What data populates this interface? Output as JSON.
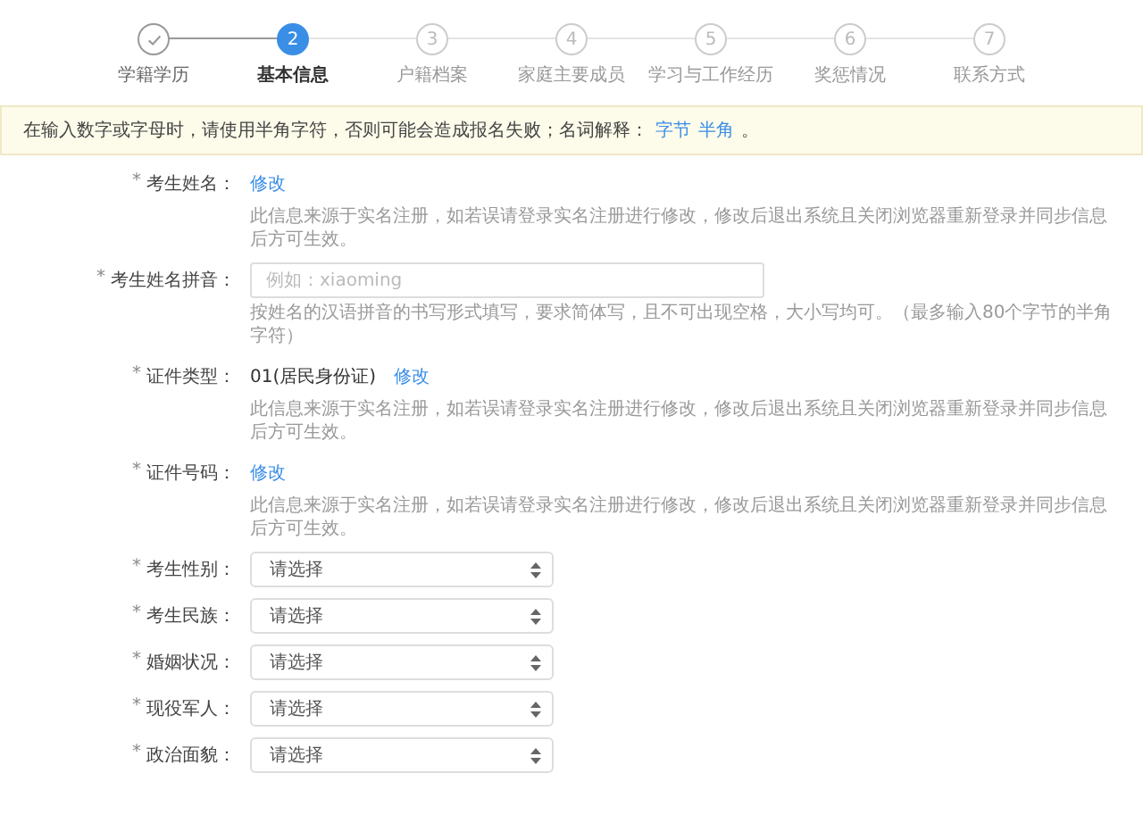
{
  "steps": [
    {
      "label": "学籍学历",
      "completed": true,
      "selected": false
    },
    {
      "number": "2",
      "label": "基本信息",
      "completed": false,
      "selected": true
    },
    {
      "number": "3",
      "label": "户籍档案",
      "completed": false,
      "selected": false
    },
    {
      "number": "4",
      "label": "家庭主要成员",
      "completed": false,
      "selected": false
    },
    {
      "number": "5",
      "label": "学习与工作经历",
      "completed": false,
      "selected": false
    },
    {
      "number": "6",
      "label": "奖惩情况",
      "completed": false,
      "selected": false
    },
    {
      "number": "7",
      "label": "联系方式",
      "completed": false,
      "selected": false
    }
  ],
  "notice": {
    "text": "在输入数字或字母时，请使用半角字符，否则可能会造成报名失败；名词解释：",
    "links": [
      "字节",
      "半角"
    ],
    "suffix": "。"
  },
  "form": [
    {
      "kind": "text",
      "required": "*",
      "label": "考生姓名：",
      "link": "修改",
      "hint": "此信息来源于实名注册，如若误请登录实名注册进行修改，修改后退出系统且关闭浏览器重新登录并同步信息后方可生效。"
    },
    {
      "kind": "input",
      "required": "*",
      "label": "考生姓名拼音：",
      "placeholder": "例如：xiaoming",
      "hint": "按姓名的汉语拼音的书写形式填写，要求简体写，且不可出现空格，大小写均可。（最多输入80个字节的半角字符）"
    },
    {
      "kind": "text",
      "required": "*",
      "label": "证件类型：",
      "value": "01(居民身份证)",
      "link": "修改",
      "hint": "此信息来源于实名注册，如若误请登录实名注册进行修改，修改后退出系统且关闭浏览器重新登录并同步信息后方可生效。"
    },
    {
      "kind": "text",
      "required": "*",
      "label": "证件号码：",
      "link": "修改",
      "hint": "此信息来源于实名注册，如若误请登录实名注册进行修改，修改后退出系统且关闭浏览器重新登录并同步信息后方可生效。"
    },
    {
      "kind": "select",
      "required": "*",
      "label": "考生性别：",
      "value": "请选择"
    },
    {
      "kind": "select",
      "required": "*",
      "label": "考生民族：",
      "value": "请选择"
    },
    {
      "kind": "select",
      "required": "*",
      "label": "婚姻状况：",
      "value": "请选择"
    },
    {
      "kind": "select",
      "required": "*",
      "label": "现役军人：",
      "value": "请选择"
    },
    {
      "kind": "select",
      "required": "*",
      "label": "政治面貌：",
      "value": "请选择"
    }
  ]
}
